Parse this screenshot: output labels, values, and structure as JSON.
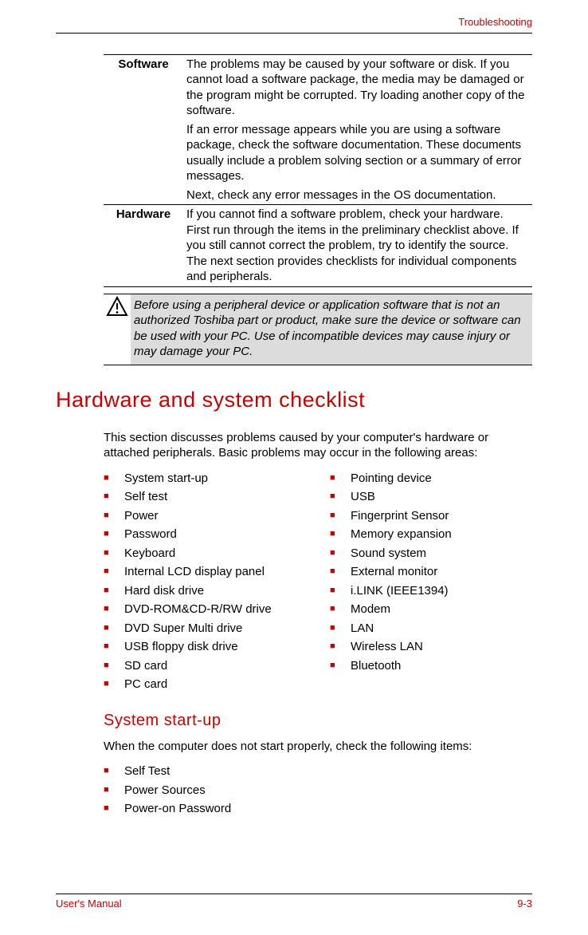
{
  "header": {
    "section": "Troubleshooting"
  },
  "table": {
    "rows": [
      {
        "term": "Software",
        "paras": [
          "The problems may be caused by your software or disk. If you cannot load a software package, the media may be damaged or the program might be corrupted. Try loading another copy of the software.",
          "If an error message appears while you are using a software package, check the software documentation. These documents usually include a problem solving section or a summary of error messages.",
          "Next, check any error messages in the OS documentation."
        ]
      },
      {
        "term": "Hardware",
        "paras": [
          "If you cannot find a software problem, check your hardware. First run through the items in the preliminary checklist above. If you still cannot correct the problem, try to identify the source. The next section provides checklists for individual components and peripherals."
        ]
      }
    ]
  },
  "callout": {
    "text": "Before using a peripheral device or application software that is not an authorized Toshiba part or product, make sure the device or software can be used with your PC. Use of incompatible devices may cause injury or may damage your PC."
  },
  "section": {
    "title": "Hardware and system checklist",
    "intro": "This section discusses problems caused by your computer's hardware or attached peripherals. Basic problems may occur in the following areas:",
    "col1": [
      "System start-up",
      "Self test",
      "Power",
      "Password",
      "Keyboard",
      "Internal LCD display panel",
      "Hard disk drive",
      "DVD-ROM&CD-R/RW drive",
      "DVD Super Multi drive",
      "USB floppy disk drive",
      "SD card",
      "PC card"
    ],
    "col2": [
      "Pointing device",
      "USB",
      "Fingerprint Sensor",
      "Memory expansion",
      "Sound system",
      "External monitor",
      "i.LINK (IEEE1394)",
      "Modem",
      "LAN",
      "Wireless LAN",
      "Bluetooth"
    ]
  },
  "subsection": {
    "title": "System start-up",
    "intro": "When the computer does not start properly, check the following items:",
    "items": [
      "Self Test",
      "Power Sources",
      "Power-on Password"
    ]
  },
  "footer": {
    "left": "User's Manual",
    "right": "9-3"
  }
}
